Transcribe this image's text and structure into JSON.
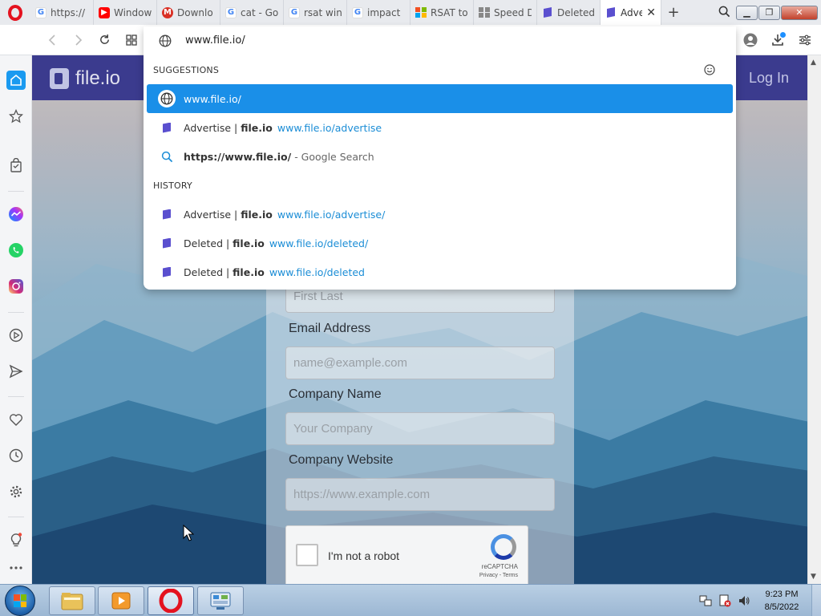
{
  "tabs": [
    {
      "title": "https://",
      "favicon": "google-icon",
      "color": "#4285f4"
    },
    {
      "title": "Window",
      "favicon": "youtube-icon",
      "color": "#ff0000"
    },
    {
      "title": "Downlo",
      "favicon": "gmail-icon",
      "color": "#d93025"
    },
    {
      "title": "cat - Go",
      "favicon": "google-icon",
      "color": "#4285f4"
    },
    {
      "title": "rsat win",
      "favicon": "google-icon",
      "color": "#4285f4"
    },
    {
      "title": "impact",
      "favicon": "google-icon",
      "color": "#4285f4"
    },
    {
      "title": "RSAT to",
      "favicon": "microsoft-icon",
      "color": "#f25022"
    },
    {
      "title": "Speed D",
      "favicon": "grid-icon",
      "color": "#888888"
    },
    {
      "title": "Deleted",
      "favicon": "fileio-icon",
      "color": "#5a4fcf"
    },
    {
      "title": "Adve",
      "favicon": "fileio-icon",
      "color": "#5a4fcf",
      "active": true
    }
  ],
  "addressbar": {
    "url": "www.file.io/"
  },
  "omnibox": {
    "suggestions_header": "SUGGESTIONS",
    "history_header": "HISTORY",
    "suggestions": [
      {
        "text": "www.file.io/",
        "icon": "globe-icon",
        "selected": true
      },
      {
        "title_prefix": "Advertise | ",
        "title_bold": "file.io",
        "url": "www.file.io/advertise",
        "icon": "fileio-icon"
      },
      {
        "bold": "https://www.file.io/",
        "suffix": "- Google Search",
        "icon": "search-icon"
      }
    ],
    "history": [
      {
        "title_prefix": "Advertise | ",
        "title_bold": "file.io",
        "url": "www.file.io/advertise/"
      },
      {
        "title_prefix": "Deleted | ",
        "title_bold": "file.io",
        "url": "www.file.io/deleted/"
      },
      {
        "title_prefix": "Deleted | ",
        "title_bold": "file.io",
        "url": "www.file.io/deleted"
      }
    ]
  },
  "site": {
    "logo_text": "file.io",
    "login": "Log In",
    "form": {
      "name_placeholder": "First Last",
      "email_label": "Email Address",
      "email_placeholder": "name@example.com",
      "company_label": "Company Name",
      "company_placeholder": "Your Company",
      "website_label": "Company Website",
      "website_placeholder": "https://www.example.com"
    },
    "recaptcha": {
      "label": "I'm not a robot",
      "brand": "reCAPTCHA",
      "links": "Privacy - Terms"
    }
  },
  "taskbar": {
    "time": "9:23 PM",
    "date": "8/5/2022"
  },
  "colors": {
    "accent": "#1a8fe8",
    "site_header": "#3b3b8e",
    "link": "#1b8dd6"
  }
}
